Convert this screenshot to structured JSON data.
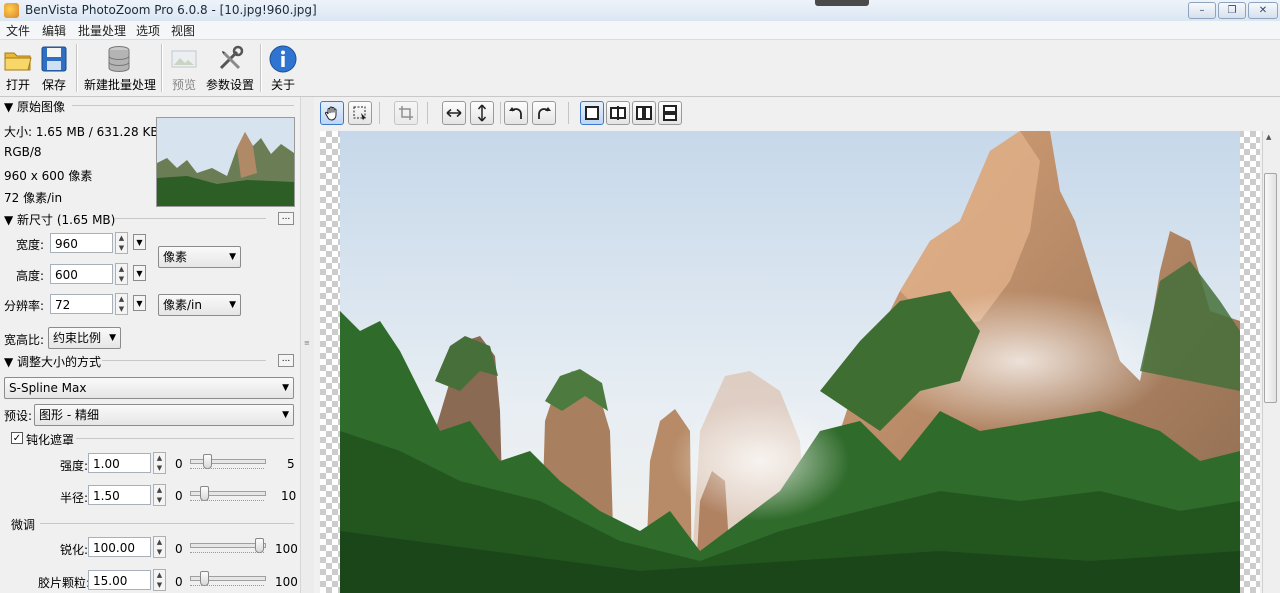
{
  "window": {
    "title": "BenVista PhotoZoom Pro 6.0.8 - [10.jpg!960.jpg]",
    "min_label": "▭",
    "max_label": "❐",
    "close_label": "✕"
  },
  "menu": [
    "文件",
    "编辑",
    "批量处理",
    "选项",
    "视图"
  ],
  "toolbar": {
    "open": "打开",
    "save": "保存",
    "new_batch": "新建批量处理",
    "preview": "预览",
    "settings": "参数设置",
    "about": "关于"
  },
  "original": {
    "header": "▼ 原始图像",
    "size": "大小: 1.65 MB / 631.28 KB",
    "mode": "RGB/8",
    "dims": "960 x 600 像素",
    "res": "72 像素/in"
  },
  "new_size": {
    "header": "▼ 新尺寸 (1.65 MB)",
    "width_label": "宽度:",
    "width": "960",
    "height_label": "高度:",
    "height": "600",
    "res_label": "分辨率:",
    "res": "72",
    "unit": "像素",
    "res_unit": "像素/in",
    "aspect_label": "宽高比:",
    "aspect": "约束比例"
  },
  "resize": {
    "header": "▼ 调整大小的方式",
    "method": "S-Spline Max",
    "preset_label": "预设:",
    "preset": "图形 - 精细"
  },
  "unsharp": {
    "checkbox_label": "钝化遮罩",
    "checked": true,
    "strength_label": "强度:",
    "strength": "1.00",
    "strength_min": "0",
    "strength_max": "5",
    "strength_level": 0.2,
    "radius_label": "半径:",
    "radius": "1.50",
    "radius_min": "0",
    "radius_max": "10",
    "radius_level": 0.15
  },
  "fine": {
    "header": "微调",
    "sharpen_label": "锐化:",
    "sharpen": "100.00",
    "sharpen_min": "0",
    "sharpen_max": "100",
    "sharpen_level": 1.0,
    "grain_label": "胶片颗粒:",
    "grain": "15.00",
    "grain_min": "0",
    "grain_max": "100",
    "grain_level": 0.15
  },
  "dots": "...",
  "icons": {
    "hand": "hand-tool-icon",
    "select": "select-rect-icon",
    "crop": "crop-icon",
    "flip_h": "flip-horizontal-icon",
    "flip_v": "flip-vertical-icon",
    "rot_l": "rotate-left-icon",
    "rot_r": "rotate-right-icon",
    "view1": "single-view-icon",
    "view2": "split-view-icon",
    "view3": "side-by-side-icon",
    "view4": "stacked-view-icon"
  },
  "colors": {
    "active_blue": "#3f78c8",
    "sky": "#dbe7f3",
    "forest": "#2f6b2a"
  }
}
